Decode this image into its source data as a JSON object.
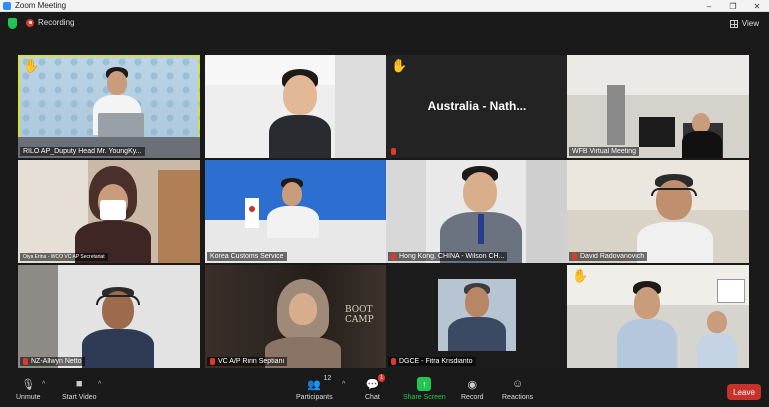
{
  "window": {
    "title": "Zoom Meeting",
    "minimize": "–",
    "maximize": "❐",
    "close": "✕"
  },
  "topbar": {
    "recording_label": "Recording",
    "view_label": "View"
  },
  "tiles": [
    {
      "name": "RILO AP_Duputy Head Mr. YoungKy..."
    },
    {
      "name": ""
    },
    {
      "name": "",
      "center_text": "Australia - Nath..."
    },
    {
      "name": "WFB Virtual Meeting"
    },
    {
      "name": "Oiya Erina - WCO VC AP Secretariat"
    },
    {
      "name": "Korea Customs Service"
    },
    {
      "name": "Hong Kong, CHINA - Wilson CH..."
    },
    {
      "name": "David Radovanovich"
    },
    {
      "name": "NZ-Allwyn Netto"
    },
    {
      "name": "VC A/P Ririn Septiani"
    },
    {
      "name": "DGCE - Fitra Krisdianto"
    },
    {
      "name": ""
    }
  ],
  "tile_texts": {
    "boot_camp": "BOOT CAMP"
  },
  "toolbar": {
    "unmute": "Unmute",
    "start_video": "Start Video",
    "participants": "Participants",
    "participants_count": "12",
    "chat": "Chat",
    "chat_badge": "1",
    "share_screen": "Share Screen",
    "record": "Record",
    "reactions": "Reactions",
    "leave": "Leave"
  },
  "colors": {
    "accent_green": "#23c552",
    "leave_red": "#c8322a",
    "active_speaker": "#d6e23a"
  }
}
